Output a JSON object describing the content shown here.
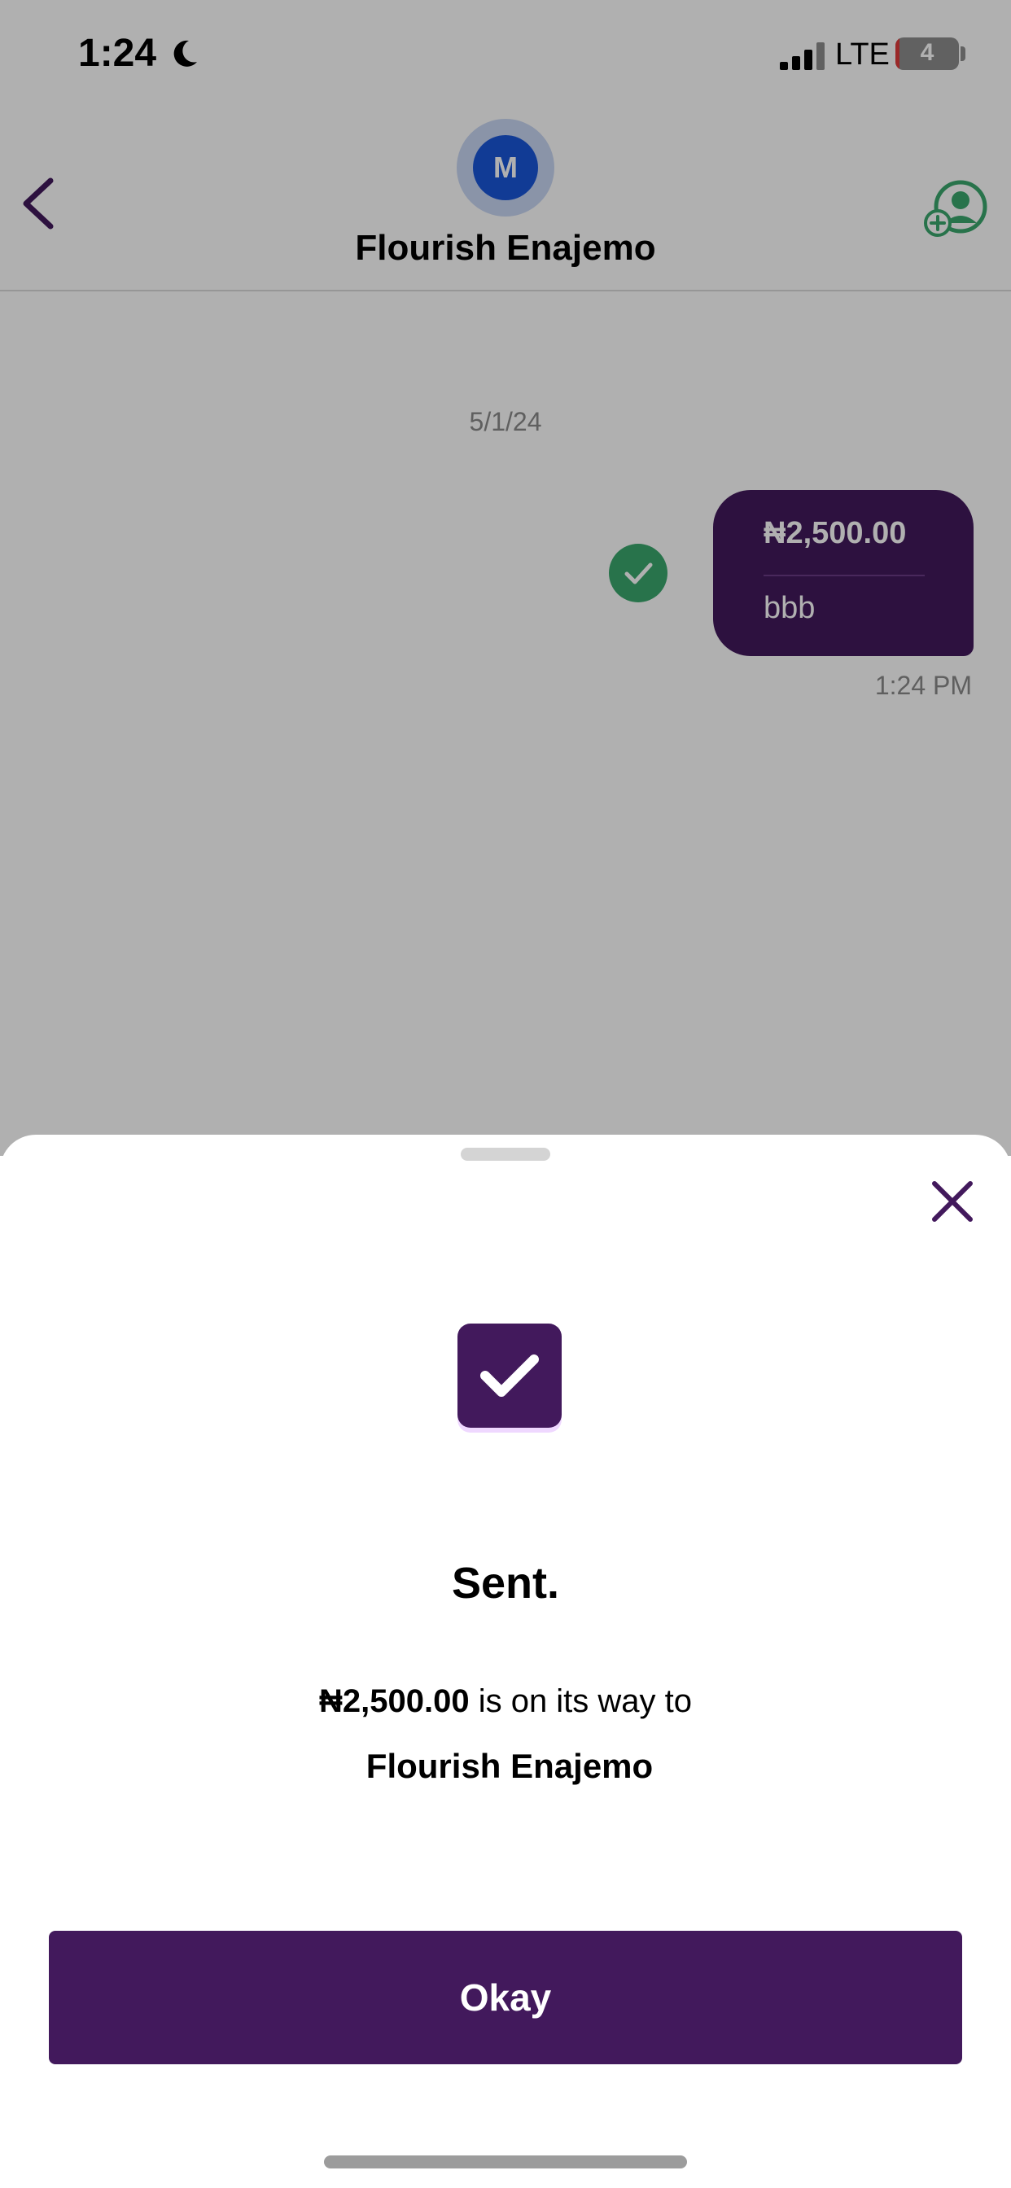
{
  "colors": {
    "brand_purple": "#42195c",
    "success_green": "#3aa76d",
    "avatar_blue": "#1a56d8"
  },
  "status_bar": {
    "time": "1:24",
    "network": "LTE",
    "battery": "4",
    "battery_level_percent": 4
  },
  "header": {
    "avatar_initial": "M",
    "contact_name": "Flourish Enajemo"
  },
  "chat": {
    "date": "5/1/24",
    "message": {
      "amount": "₦2,500.00",
      "note": "bbb",
      "time": "1:24 PM",
      "status_icon": "check-circle-icon"
    }
  },
  "sheet": {
    "title": "Sent.",
    "amount": "₦2,500.00",
    "message_suffix": " is on its way to",
    "recipient": "Flourish Enajemo",
    "okay_label": "Okay"
  }
}
